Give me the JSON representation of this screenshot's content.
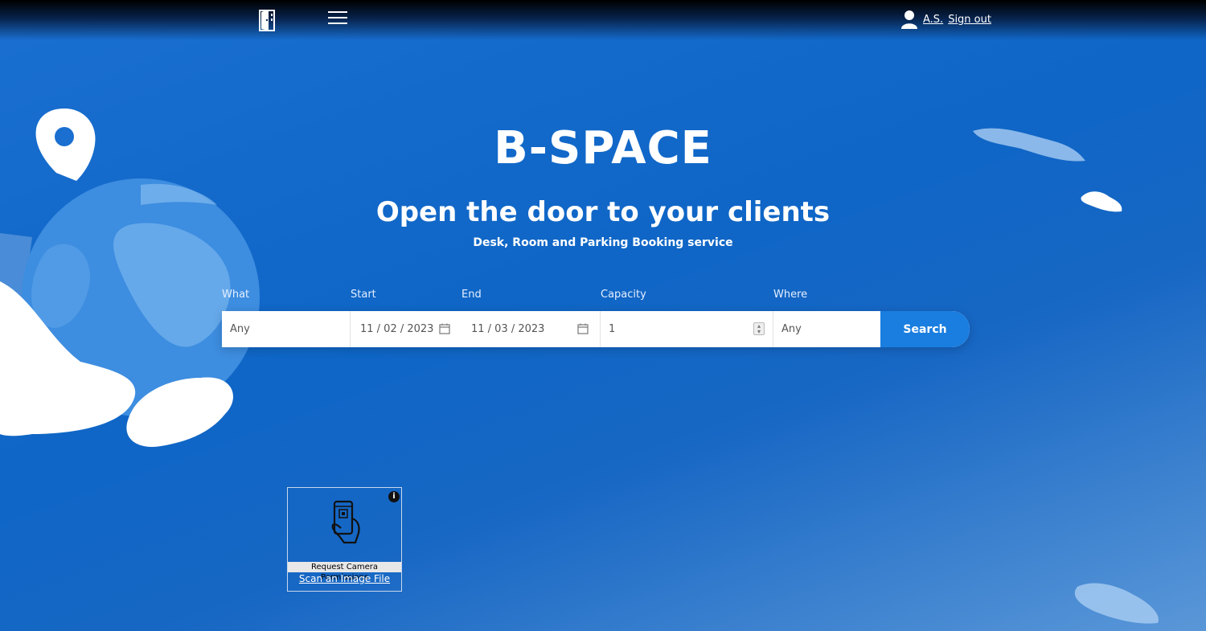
{
  "header": {
    "logo_icon": "door-logo-icon",
    "menu_icon": "hamburger-menu-icon",
    "user_icon": "user-icon",
    "user_initials": "A.S.",
    "sign_out_label": "Sign out"
  },
  "hero": {
    "title": "B-SPACE",
    "subtitle": "Open the door to your clients",
    "tagline": "Desk, Room and Parking Booking service"
  },
  "search": {
    "labels": {
      "what": "What",
      "start": "Start",
      "end": "End",
      "capacity": "Capacity",
      "where": "Where"
    },
    "what_value": "Any",
    "start_value": "11 / 02 / 2023",
    "end_value": "11 / 03 / 2023",
    "capacity_value": "1",
    "where_value": "Any",
    "button_label": "Search"
  },
  "qr_scanner": {
    "icon": "phone-qr-scan-icon",
    "info_icon": "info-icon",
    "info_glyph": "i",
    "camera_button": "Request Camera Permissions",
    "scan_file_link": "Scan an Image File"
  },
  "colors": {
    "background": "#0f66c6",
    "search_button": "#1a7ee0",
    "text": "#ffffff"
  }
}
